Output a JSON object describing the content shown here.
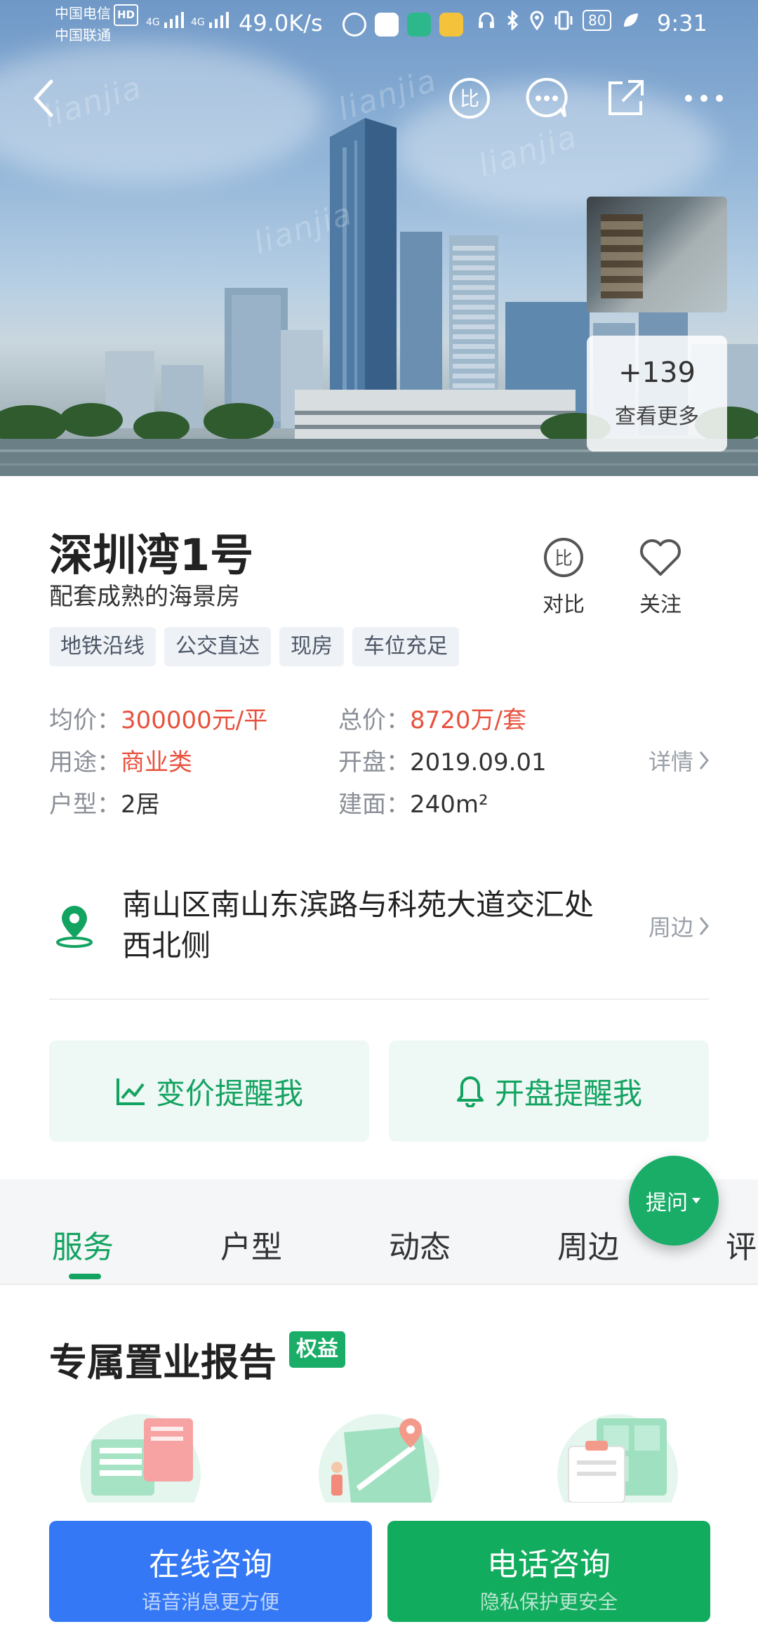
{
  "status_bar": {
    "carrier1": "中国电信",
    "carrier1_badge": "HD",
    "carrier2": "中国联通",
    "signal1_label": "4G",
    "signal2_label": "4G",
    "net_speed": "49.0K/s",
    "battery": "80",
    "time": "9:31"
  },
  "gallery": {
    "more_count": "+139",
    "more_label": "查看更多"
  },
  "project": {
    "name": "深圳湾1号",
    "slogan": "配套成熟的海景房",
    "compare_label": "对比",
    "follow_label": "关注",
    "tags": [
      "地铁沿线",
      "公交直达",
      "现房",
      "车位充足"
    ]
  },
  "details": {
    "avg_price_label": "均价：",
    "avg_price": "300000元/平",
    "total_price_label": "总价：",
    "total_price": "8720万/套",
    "usage_label": "用途：",
    "usage": "商业类",
    "open_label": "开盘：",
    "open_date": "2019.09.01",
    "layout_label": "户型：",
    "layout": "2居",
    "area_label": "建面：",
    "area": "240m²",
    "detail_link": "详情"
  },
  "location": {
    "address": "南山区南山东滨路与科苑大道交汇处西北侧",
    "nearby_link": "周边"
  },
  "reminders": {
    "price_change": "变价提醒我",
    "opening": "开盘提醒我"
  },
  "ask_fab": "提问",
  "tabs": [
    "服务",
    "户型",
    "动态",
    "周边",
    "评"
  ],
  "report": {
    "title": "专属置业报告",
    "badge": "权益"
  },
  "bottom_bar": {
    "online_title": "在线咨询",
    "online_sub": "语音消息更方便",
    "phone_title": "电话咨询",
    "phone_sub": "隐私保护更安全"
  },
  "colors": {
    "accent_green": "#13a361",
    "price_red": "#e8513e",
    "online_blue": "#3478f6",
    "phone_green": "#12ac5e"
  }
}
